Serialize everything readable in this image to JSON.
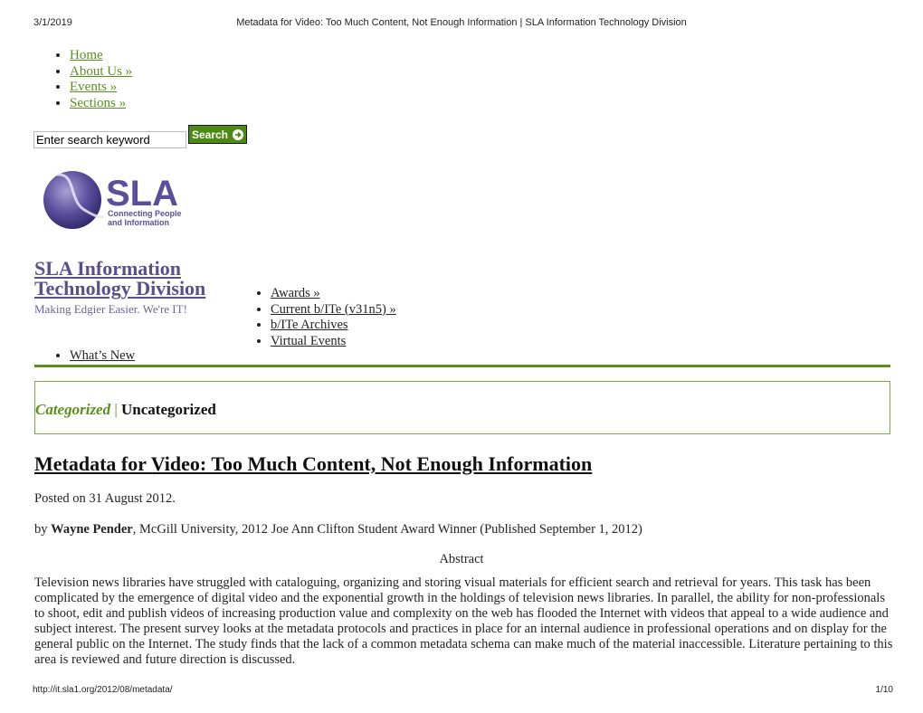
{
  "print_header": {
    "date": "3/1/2019",
    "title": "Metadata for Video: Too Much Content, Not Enough Information | SLA Information Technology Division"
  },
  "primary_nav": [
    {
      "label": "Home"
    },
    {
      "label": "About Us »"
    },
    {
      "label": "Events »"
    },
    {
      "label": "Sections »"
    }
  ],
  "search": {
    "value": "Enter search keyword",
    "button_label": "Search",
    "button_icon": "arrow-circle-icon",
    "button_color": "#4d8a14"
  },
  "logo": {
    "wordmark": "SLA",
    "tagline_line1": "Connecting People",
    "tagline_line2": "and Information",
    "color": "#4a3f8a"
  },
  "site": {
    "title_line1": "SLA Information",
    "title_line2": "Technology Division",
    "tagline": "Making Edgier Easier. We're IT!"
  },
  "secondary_nav": [
    {
      "label": "Awards »"
    },
    {
      "label": "Current b/ITe (v31n5) »"
    },
    {
      "label": "b/ITe Archives"
    },
    {
      "label": "Virtual Events"
    }
  ],
  "tertiary_nav": [
    {
      "label": "What’s New"
    }
  ],
  "category": {
    "prefix": "Categorized",
    "separator": "|",
    "name": "Uncategorized"
  },
  "post": {
    "title": "Metadata for Video: Too Much Content, Not Enough Information",
    "posted": "Posted on 31 August 2012.",
    "by": "by ",
    "author": "Wayne Pender",
    "author_rest": ", McGill University, 2012 Joe Ann Clifton Student Award Winner (Published September 1, 2012)",
    "abstract_heading": "Abstract",
    "abstract": "Television news libraries have struggled with cataloguing, organizing and storing visual materials for efficient search and retrieval for years. This task has been complicated by the emergence of digital video and the exponential growth in the holdings of television news libraries. In parallel, the ability for non-professionals to shoot, edit and publish videos of increasing production value and complexity on the web has flooded the Internet with videos that appeal to a wide audience and subject interest. The present survey looks at the metadata protocols and practices in place for an internal audience in professional operations and on display for the general public on the Internet. The study finds that the lack of a common metadata schema can make much of the material inaccessible. Literature pertaining to this area is reviewed and future direction is discussed."
  },
  "print_footer": {
    "url": "http://it.sla1.org/2012/08/metadata/",
    "page": "1/10"
  }
}
